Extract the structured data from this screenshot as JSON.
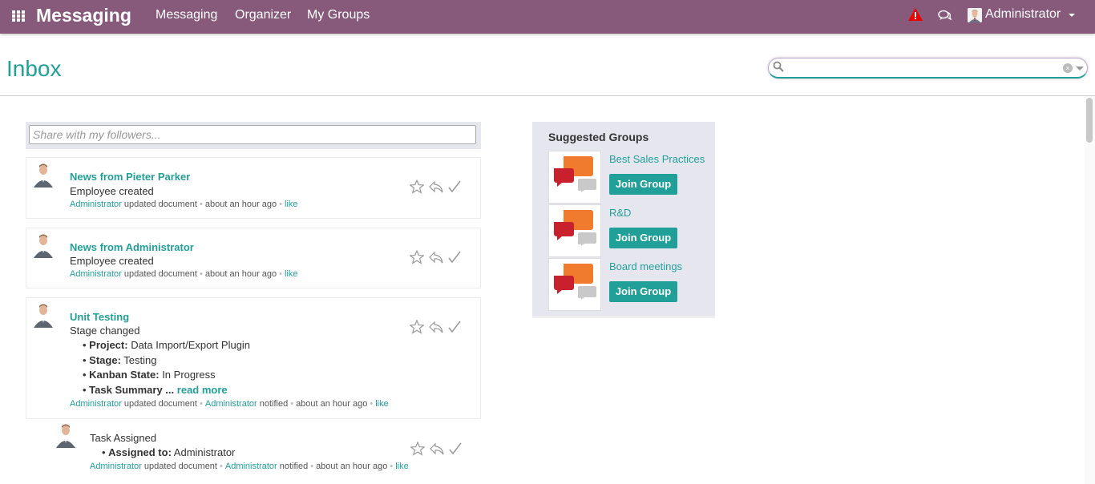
{
  "topbar": {
    "brand": "Messaging",
    "menu": [
      "Messaging",
      "Organizer",
      "My Groups"
    ],
    "user": "Administrator",
    "icons": [
      "apps-grid-icon",
      "warning-icon",
      "chat-icon"
    ]
  },
  "page": {
    "title": "Inbox",
    "search_placeholder": ""
  },
  "compose": {
    "placeholder": "Share with my followers..."
  },
  "messages": [
    {
      "title": "News from Pieter Parker",
      "body": "Employee created",
      "author": "Administrator",
      "action": "updated document",
      "time": "about an hour ago",
      "like": "like"
    },
    {
      "title": "News from Administrator",
      "body": "Employee created",
      "author": "Administrator",
      "action": "updated document",
      "time": "about an hour ago",
      "like": "like"
    },
    {
      "title": "Unit Testing",
      "body": "Stage changed",
      "details": [
        {
          "label": "Project:",
          "value": " Data Import/Export Plugin"
        },
        {
          "label": "Stage:",
          "value": " Testing"
        },
        {
          "label": "Kanban State:",
          "value": " In Progress"
        },
        {
          "label": "Task Summary ...",
          "value": ""
        }
      ],
      "read_more": "read more",
      "author": "Administrator",
      "action": "updated document",
      "notified_user": "Administrator",
      "notified": "notified",
      "time": "about an hour ago",
      "like": "like"
    },
    {
      "title": "",
      "body": "Task Assigned",
      "details": [
        {
          "label": "Assigned to:",
          "value": " Administrator"
        }
      ],
      "author": "Administrator",
      "action": "updated document",
      "notified_user": "Administrator",
      "notified": "notified",
      "time": "about an hour ago",
      "like": "like"
    }
  ],
  "suggested_groups": {
    "title": "Suggested Groups",
    "join_label": "Join Group",
    "groups": [
      {
        "name": "Best Sales Practices"
      },
      {
        "name": "R&D"
      },
      {
        "name": "Board meetings"
      }
    ]
  },
  "colors": {
    "topbar": "#875a7b",
    "accent": "#21a09a",
    "panel": "#e6e6ef"
  }
}
